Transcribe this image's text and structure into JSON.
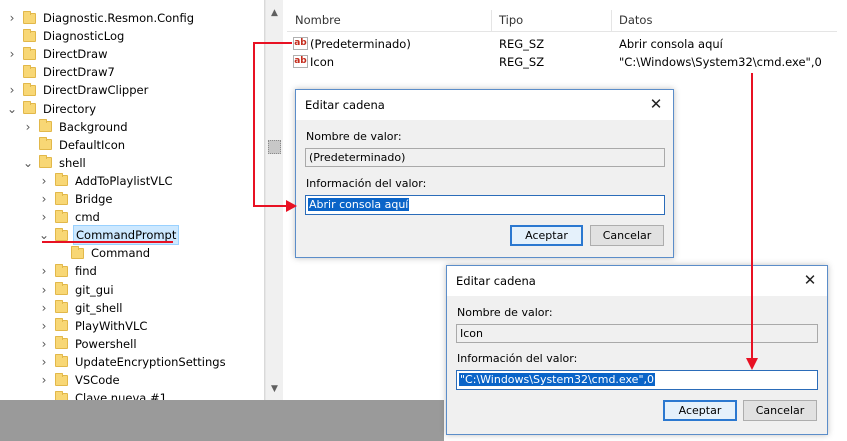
{
  "tree": {
    "items": [
      {
        "label": "Diagnostic.Resmon.Config",
        "chev": "›",
        "level": 0
      },
      {
        "label": "DiagnosticLog",
        "chev": "",
        "level": 0
      },
      {
        "label": "DirectDraw",
        "chev": "›",
        "level": 0
      },
      {
        "label": "DirectDraw7",
        "chev": "",
        "level": 0
      },
      {
        "label": "DirectDrawClipper",
        "chev": "›",
        "level": 0
      },
      {
        "label": "Directory",
        "chev": "⌄",
        "level": 0
      },
      {
        "label": "Background",
        "chev": "›",
        "level": 1
      },
      {
        "label": "DefaultIcon",
        "chev": "",
        "level": 1
      },
      {
        "label": "shell",
        "chev": "⌄",
        "level": 1
      },
      {
        "label": "AddToPlaylistVLC",
        "chev": "›",
        "level": 2
      },
      {
        "label": "Bridge",
        "chev": "›",
        "level": 2
      },
      {
        "label": "cmd",
        "chev": "›",
        "level": 2
      },
      {
        "label": "CommandPrompt",
        "chev": "⌄",
        "level": 2
      },
      {
        "label": "Command",
        "chev": "",
        "level": 3
      },
      {
        "label": "find",
        "chev": "›",
        "level": 2
      },
      {
        "label": "git_gui",
        "chev": "›",
        "level": 2
      },
      {
        "label": "git_shell",
        "chev": "›",
        "level": 2
      },
      {
        "label": "PlayWithVLC",
        "chev": "›",
        "level": 2
      },
      {
        "label": "Powershell",
        "chev": "›",
        "level": 2
      },
      {
        "label": "UpdateEncryptionSettings",
        "chev": "›",
        "level": 2
      },
      {
        "label": "VSCode",
        "chev": "›",
        "level": 2
      },
      {
        "label": "Clave nueva #1",
        "chev": "",
        "level": 2
      }
    ]
  },
  "list": {
    "headers": {
      "name": "Nombre",
      "type": "Tipo",
      "data": "Datos"
    },
    "rows": [
      {
        "icon": "ab",
        "name": "(Predeterminado)",
        "type": "REG_SZ",
        "data": "Abrir consola aquí"
      },
      {
        "icon": "ab",
        "name": "Icon",
        "type": "REG_SZ",
        "data": "\"C:\\Windows\\System32\\cmd.exe\",0"
      }
    ]
  },
  "dialog1": {
    "title": "Editar cadena",
    "name_label": "Nombre de valor:",
    "name_value": "(Predeterminado)",
    "data_label": "Información del valor:",
    "data_value": "Abrir consola aquí",
    "ok": "Aceptar",
    "cancel": "Cancelar"
  },
  "dialog2": {
    "title": "Editar cadena",
    "name_label": "Nombre de valor:",
    "name_value": "Icon",
    "data_label": "Información del valor:",
    "data_value": "\"C:\\Windows\\System32\\cmd.exe\",0",
    "ok": "Aceptar",
    "cancel": "Cancelar"
  },
  "icons": {
    "close": "✕",
    "scroll_up": "▲",
    "scroll_down": "▼",
    "value_icon": "ab"
  },
  "colors": {
    "annotation_red": "#e81123",
    "selection_blue": "#0a64c8",
    "folder_yellow": "#f8d775"
  }
}
